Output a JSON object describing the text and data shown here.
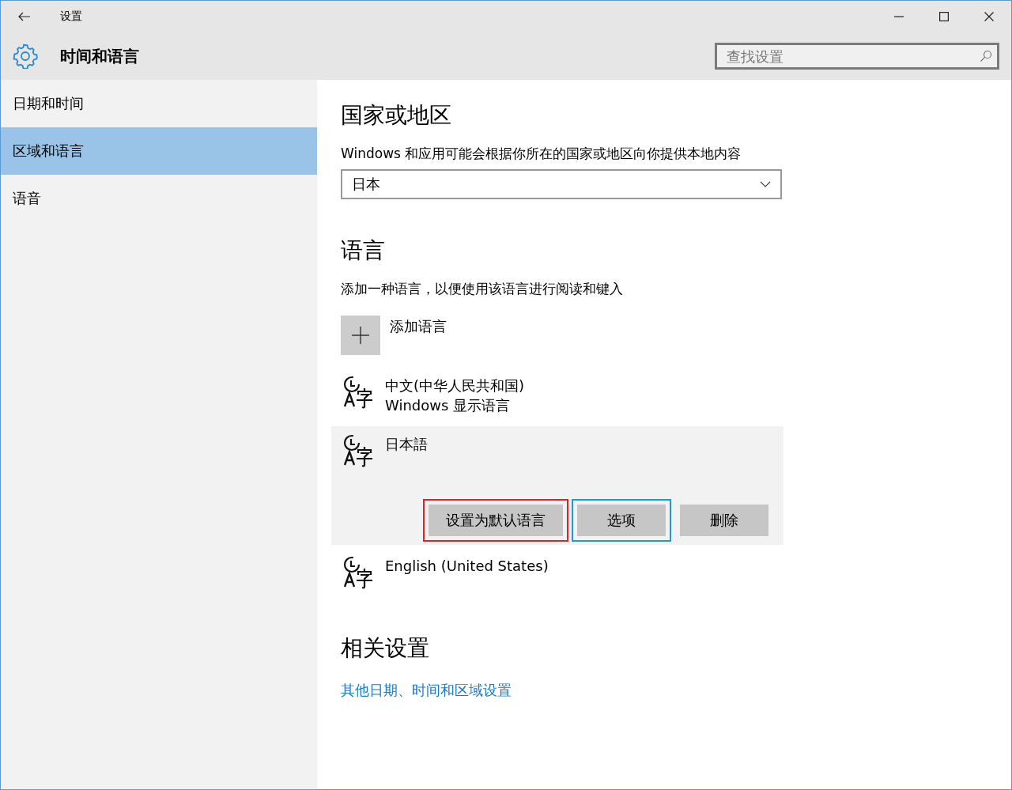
{
  "window": {
    "title": "设置"
  },
  "header": {
    "title": "时间和语言",
    "search": {
      "placeholder": "查找设置"
    }
  },
  "sidebar": {
    "items": [
      {
        "label": "日期和时间",
        "selected": false
      },
      {
        "label": "区域和语言",
        "selected": true
      },
      {
        "label": "语音",
        "selected": false
      }
    ]
  },
  "region": {
    "heading": "国家或地区",
    "description": "Windows 和应用可能会根据你所在的国家或地区向你提供本地内容",
    "dropdown": {
      "value": "日本"
    }
  },
  "language": {
    "heading": "语言",
    "description": "添加一种语言，以便使用该语言进行阅读和键入",
    "add_label": "添加语言",
    "languages": [
      {
        "name": "中文(中华人民共和国)",
        "subtitle": "Windows 显示语言",
        "selected": false
      },
      {
        "name": "日本語",
        "selected": true,
        "buttons": [
          {
            "label": "设置为默认语言",
            "color": "#d7262f"
          },
          {
            "label": "选项",
            "color": "#1e9ad6"
          },
          {
            "label": "删除"
          }
        ]
      },
      {
        "name": "English (United States)",
        "selected": false
      }
    ]
  },
  "related": {
    "heading": "相关设置",
    "link": "其他日期、时间和区域设置"
  }
}
